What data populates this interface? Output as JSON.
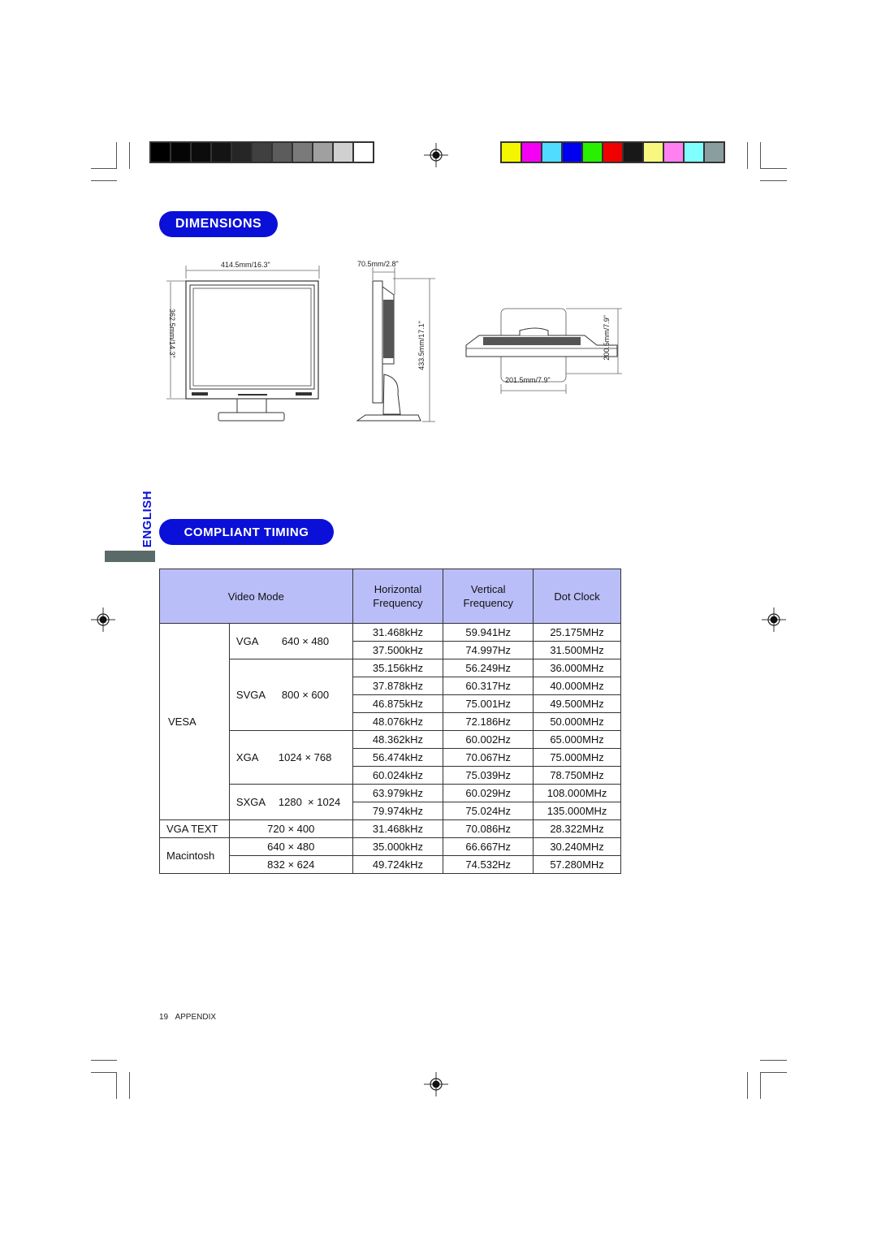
{
  "registration": {
    "grayscale_swatches": [
      "#000000",
      "#050505",
      "#0c0c0c",
      "#141414",
      "#262626",
      "#404040",
      "#5c5c5c",
      "#7a7a7a",
      "#a0a0a0",
      "#d0d0d0",
      "#ffffff"
    ],
    "color_swatches": [
      "#f5f500",
      "#f500f5",
      "#50dcff",
      "#0000f0",
      "#28f000",
      "#f00000",
      "#181818",
      "#f8f880",
      "#ff80f0",
      "#80ffff",
      "#8a9ea0"
    ],
    "target_icon": "registration-target-icon"
  },
  "dimensions": {
    "heading": "DIMENSIONS",
    "front_width": "414.5mm/16.3\"",
    "front_height": "362.5mm/14.3\"",
    "side_depth": "70.5mm/2.8\"",
    "side_height": "433.5mm/17.1\"",
    "top_base_width": "201.5mm/7.9\"",
    "top_base_depth": "200.5mm/7.9\""
  },
  "side_tab": {
    "language": "ENGLISH"
  },
  "timing": {
    "heading": "COMPLIANT TIMING",
    "headers": {
      "video_mode": "Video Mode",
      "horizontal_1": "Horizontal",
      "horizontal_2": "Frequency",
      "vertical_1": "Vertical",
      "vertical_2": "Frequency",
      "dot_clock": "Dot Clock"
    },
    "groups": {
      "vesa": "VESA",
      "vga_text": "VGA TEXT",
      "macintosh": "Macintosh"
    },
    "modes": {
      "vga": "VGA",
      "vga_res": "640 × 480",
      "svga": "SVGA",
      "svga_res": "800 × 600",
      "xga": "XGA",
      "xga_res": "1024 × 768",
      "sxga": "SXGA",
      "sxga_res": "1280  × 1024",
      "text_res": "720 × 400",
      "mac_res_1": "640 × 480",
      "mac_res_2": "832 × 624"
    },
    "rows": [
      {
        "h": "31.468kHz",
        "v": "59.941Hz",
        "d": "25.175MHz"
      },
      {
        "h": "37.500kHz",
        "v": "74.997Hz",
        "d": "31.500MHz"
      },
      {
        "h": "35.156kHz",
        "v": "56.249Hz",
        "d": "36.000MHz"
      },
      {
        "h": "37.878kHz",
        "v": "60.317Hz",
        "d": "40.000MHz"
      },
      {
        "h": "46.875kHz",
        "v": "75.001Hz",
        "d": "49.500MHz"
      },
      {
        "h": "48.076kHz",
        "v": "72.186Hz",
        "d": "50.000MHz"
      },
      {
        "h": "48.362kHz",
        "v": "60.002Hz",
        "d": "65.000MHz"
      },
      {
        "h": "56.474kHz",
        "v": "70.067Hz",
        "d": "75.000MHz"
      },
      {
        "h": "60.024kHz",
        "v": "75.039Hz",
        "d": "78.750MHz"
      },
      {
        "h": "63.979kHz",
        "v": "60.029Hz",
        "d": "108.000MHz"
      },
      {
        "h": "79.974kHz",
        "v": "75.024Hz",
        "d": "135.000MHz"
      },
      {
        "h": "31.468kHz",
        "v": "70.086Hz",
        "d": "28.322MHz"
      },
      {
        "h": "35.000kHz",
        "v": "66.667Hz",
        "d": "30.240MHz"
      },
      {
        "h": "49.724kHz",
        "v": "74.532Hz",
        "d": "57.280MHz"
      }
    ]
  },
  "footer": {
    "page_number": "19",
    "section": "APPENDIX"
  }
}
